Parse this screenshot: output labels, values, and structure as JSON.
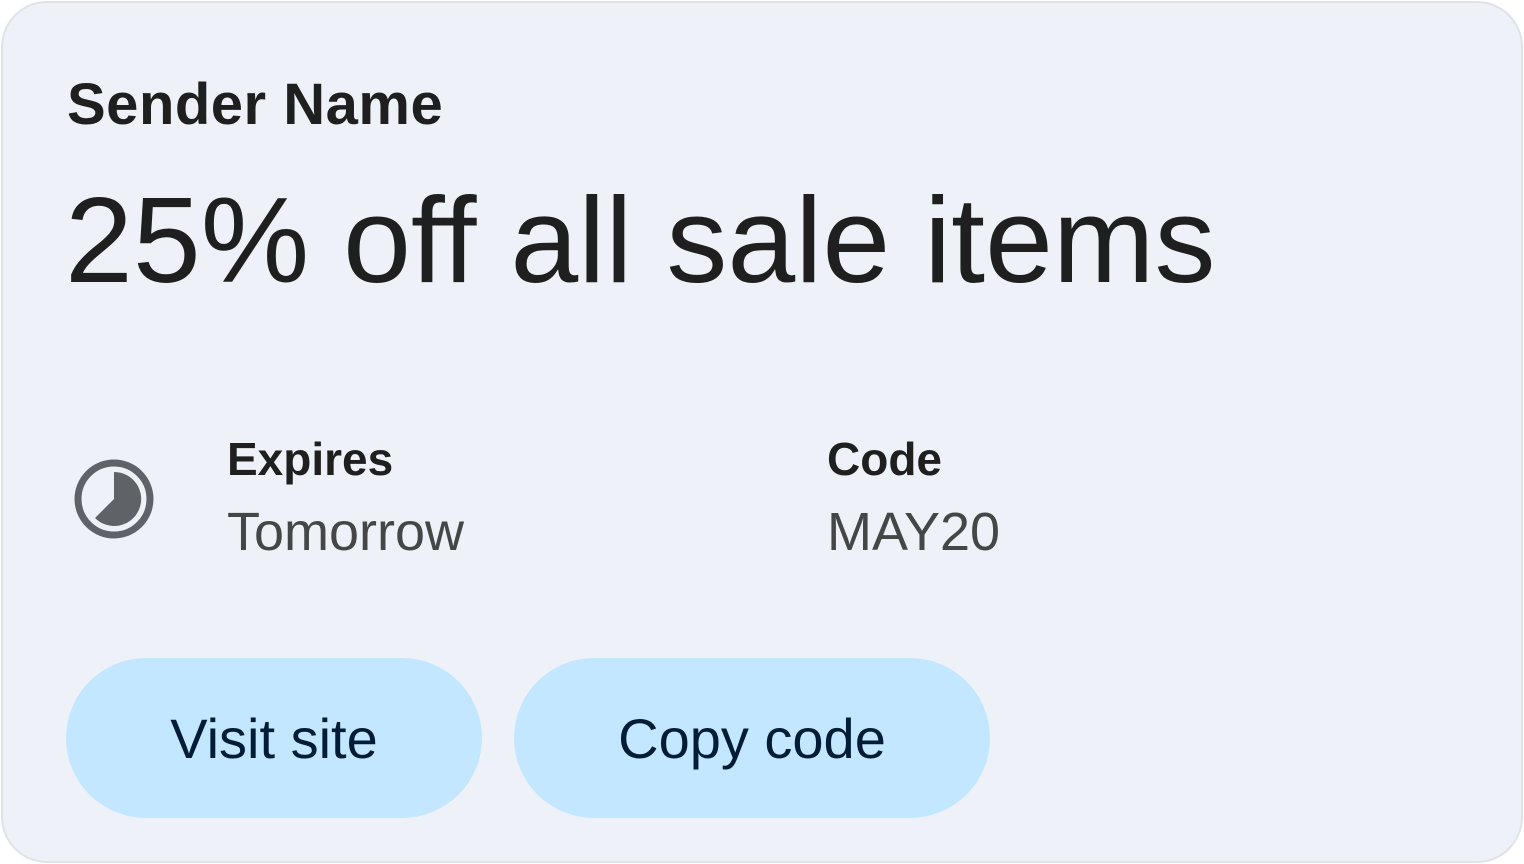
{
  "card": {
    "sender_name": "Sender Name",
    "headline": "25% off all sale items",
    "details": {
      "expires_label": "Expires",
      "expires_value": "Tomorrow",
      "expires_icon": "timer-icon",
      "code_label": "Code",
      "code_value": "MAY20"
    },
    "actions": {
      "visit_label": "Visit site",
      "copy_label": "Copy code"
    }
  },
  "colors": {
    "card_background": "#eef2f8",
    "card_border": "#dfe3e7",
    "button_background": "#c3e7ff",
    "button_text": "#001d35",
    "primary_text": "#1f1f1f",
    "secondary_text": "#444746",
    "icon": "#5f6368"
  }
}
